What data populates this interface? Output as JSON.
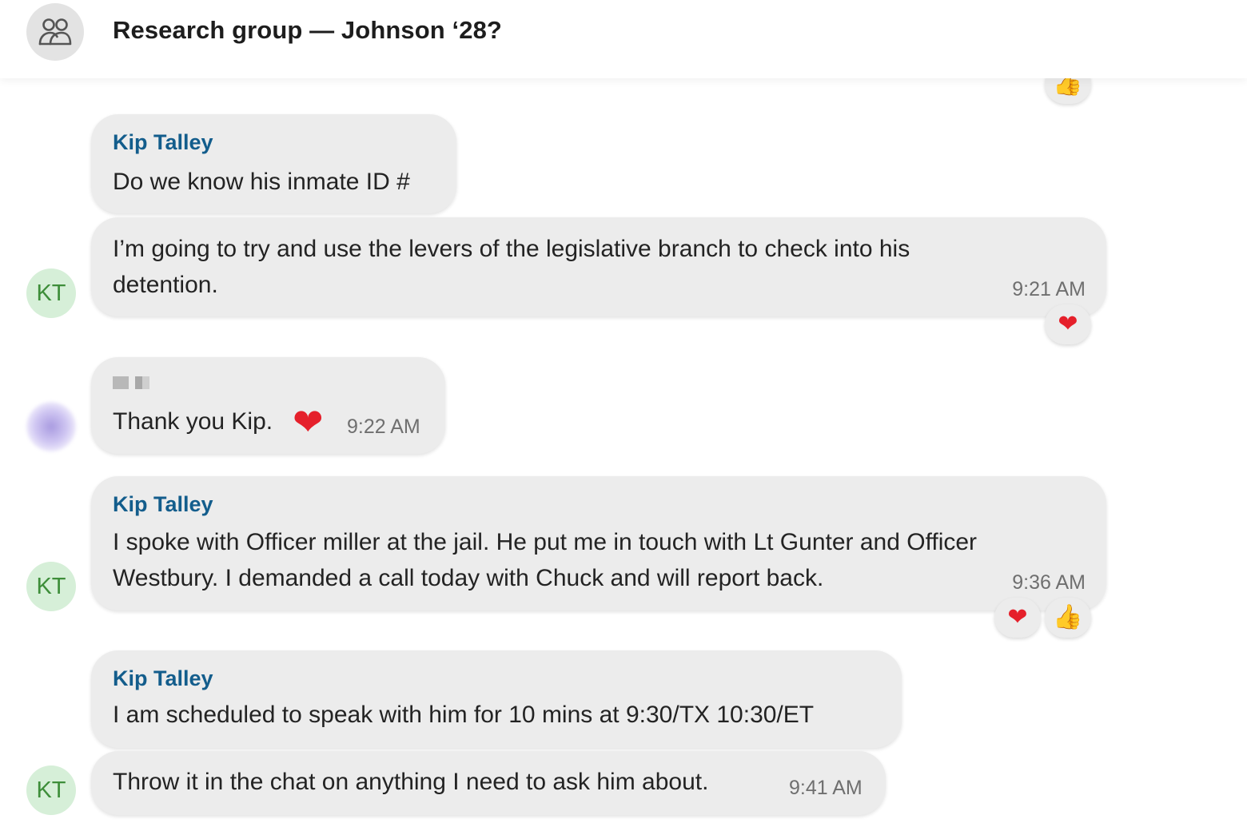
{
  "header": {
    "title": "Research group — Johnson ‘28?",
    "icon": "people-group-icon"
  },
  "reactions": {
    "heart": "❤",
    "thumbs_up": "👍"
  },
  "messages": [
    {
      "sender": "Kip Talley",
      "text": "Do we know his inmate ID #"
    },
    {
      "text_line1": "I’m going to try and use the levers of the legislative branch to  check into his",
      "text_line2": "detention.",
      "time": "9:21 AM",
      "avatar": "KT"
    },
    {
      "text": "Thank you Kip.",
      "time": "9:22 AM"
    },
    {
      "sender": "Kip Talley",
      "text_line1": "I spoke with Officer miller at the jail. He put me in touch with Lt Gunter and Officer",
      "text_line2": "Westbury. I demanded a call today with Chuck and will report back.",
      "time": "9:36 AM",
      "avatar": "KT"
    },
    {
      "sender": "Kip Talley",
      "text": "I am scheduled to speak with him for 10 mins at 9:30/TX 10:30/ET"
    },
    {
      "text": "Throw it in the chat on anything I need to ask him about.",
      "time": "9:41 AM",
      "avatar": "KT"
    }
  ]
}
